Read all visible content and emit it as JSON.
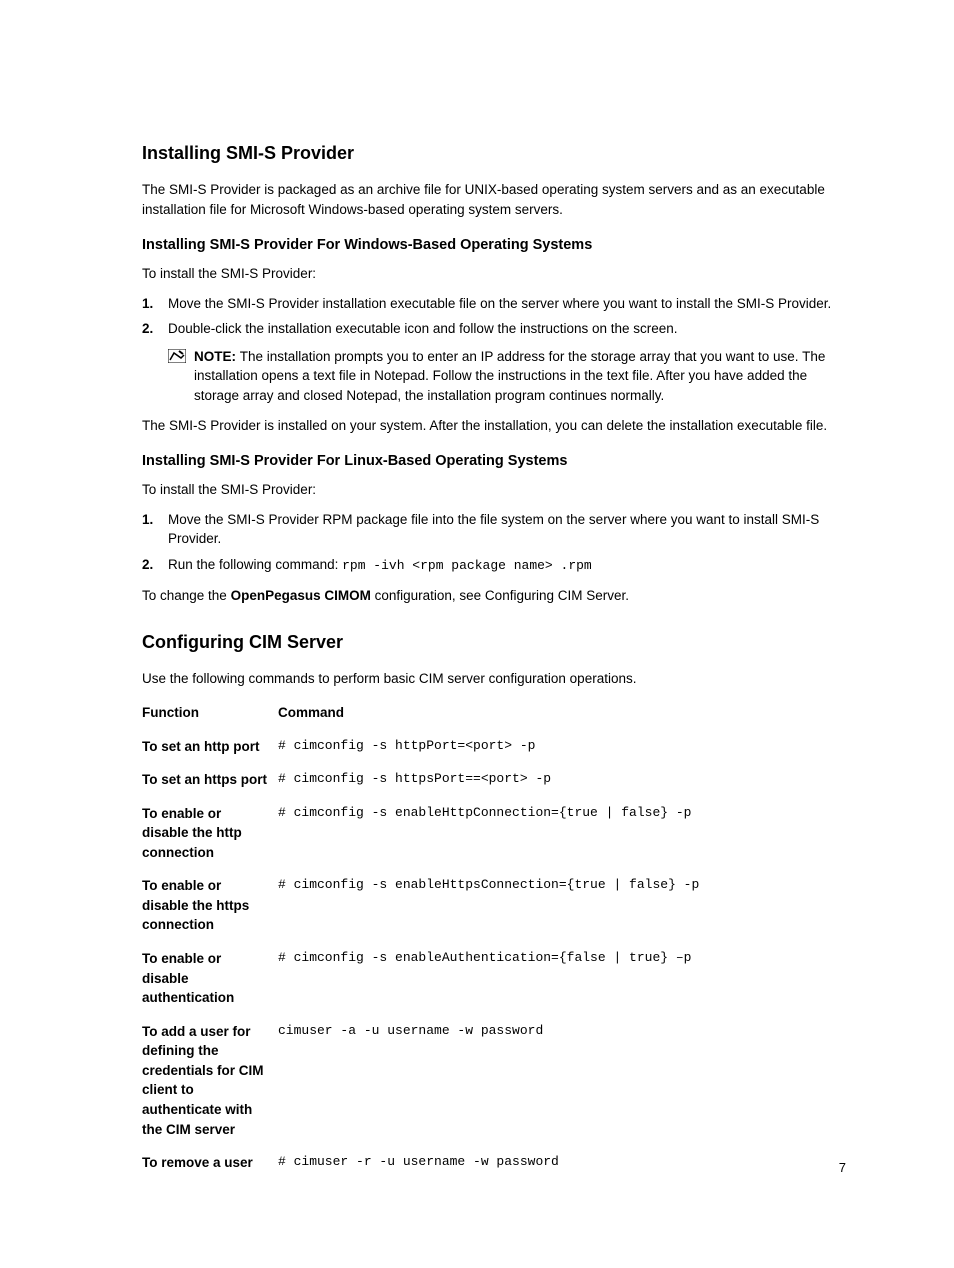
{
  "h1": "Installing SMI-S Provider",
  "intro": "The SMI-S Provider is packaged as an archive file for UNIX-based operating system servers and as an executable installation file for Microsoft Windows-based operating system servers.",
  "winH": "Installing SMI-S Provider For Windows-Based Operating Systems",
  "winIntro": "To install the SMI-S Provider:",
  "winSteps": [
    "Move the SMI-S Provider installation executable file on the server where you want to install the SMI-S Provider.",
    "Double-click the installation executable icon and follow the instructions on the screen."
  ],
  "noteLabel": "NOTE: ",
  "noteBody": "The installation prompts you to enter an IP address for the storage array that you want to use. The installation opens a text file in Notepad. Follow the instructions in the text file. After you have added the storage array and closed Notepad, the installation program continues normally.",
  "winAfter": "The SMI-S Provider is installed on your system. After the installation, you can delete the installation executable file.",
  "linH": "Installing SMI-S Provider For Linux-Based Operating Systems",
  "linIntro": "To install the SMI-S Provider:",
  "linStep1": "Move the SMI-S Provider RPM package file into the file system on the server where you want to install SMI-S Provider.",
  "linStep2a": "Run the following command: ",
  "linStep2b": "rpm -ivh <rpm package name> .rpm",
  "linAfterA": "To change the ",
  "linAfterB": "OpenPegasus CIMOM",
  "linAfterC": " configuration, see Configuring CIM Server.",
  "h2": "Configuring CIM Server",
  "cimIntro": "Use the following commands to perform basic CIM server configuration operations.",
  "thFunc": "Function",
  "thCmd": "Command",
  "rows": [
    {
      "f": "To set an http port",
      "c": "# cimconfig -s httpPort=<port> -p"
    },
    {
      "f": "To set an https port",
      "c": "# cimconfig -s httpsPort==<port> -p"
    },
    {
      "f": "To enable or disable the http connection",
      "c": "# cimconfig -s enableHttpConnection={true | false} -p"
    },
    {
      "f": "To enable or disable the https connection",
      "c": "# cimconfig -s enableHttpsConnection={true | false} -p"
    },
    {
      "f": "To enable or disable authentication",
      "c": "# cimconfig -s enableAuthentication={false | true} –p"
    },
    {
      "f": "To add a user for defining the credentials for CIM client to authenticate with the CIM server",
      "c": "cimuser -a -u username -w password"
    },
    {
      "f": "To remove a user",
      "c": "# cimuser -r -u username -w password"
    }
  ],
  "page": "7"
}
